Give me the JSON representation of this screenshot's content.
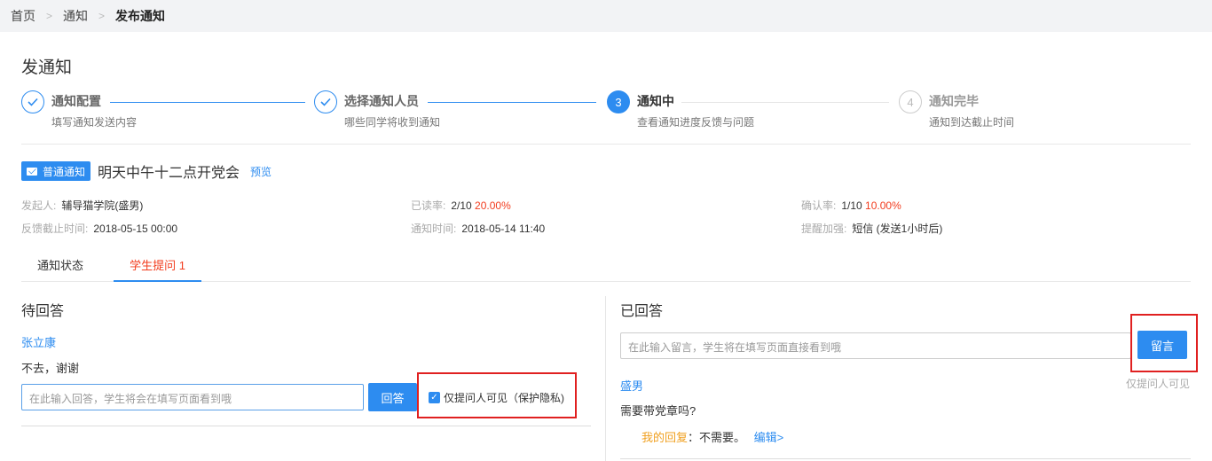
{
  "breadcrumb": {
    "home": "首页",
    "notice": "通知",
    "current": "发布通知"
  },
  "page_title": "发通知",
  "steps": [
    {
      "title": "通知配置",
      "desc": "填写通知发送内容",
      "status": "done",
      "icon": "check-icon"
    },
    {
      "title": "选择通知人员",
      "desc": "哪些同学将收到通知",
      "status": "done",
      "icon": "check-icon"
    },
    {
      "title": "通知中",
      "desc": "查看通知进度反馈与问题",
      "status": "active",
      "number": "3"
    },
    {
      "title": "通知完毕",
      "desc": "通知到达截止时间",
      "status": "todo",
      "number": "4"
    }
  ],
  "notice": {
    "badge": "普通通知",
    "title": "明天中午十二点开党会",
    "preview": "预览"
  },
  "meta": {
    "initiator_label": "发起人:",
    "initiator": "辅导猫学院(盛男)",
    "deadline_label": "反馈截止时间:",
    "deadline": "2018-05-15 00:00",
    "read_label": "已读率:",
    "read_count": "2/10",
    "read_pct": "20.00%",
    "notify_time_label": "通知时间:",
    "notify_time": "2018-05-14 11:40",
    "confirm_label": "确认率:",
    "confirm_count": "1/10",
    "confirm_pct": "10.00%",
    "remind_label": "提醒加强:",
    "remind": "短信 (发送1小时后)"
  },
  "tabs": {
    "status": "通知状态",
    "questions": "学生提问 1"
  },
  "pending": {
    "title": "待回答",
    "asker": "张立康",
    "question": "不去，谢谢",
    "reply_placeholder": "在此输入回答，学生将会在填写页面看到哦",
    "reply_button": "回答",
    "private_label": "仅提问人可见（保护隐私)",
    "private_checked": true
  },
  "answered": {
    "title": "已回答",
    "message_placeholder": "在此输入留言，学生将在填写页面直接看到哦",
    "message_button": "留言",
    "visibility_hint": "仅提问人可见",
    "asker": "盛男",
    "question": "需要带党章吗?",
    "my_reply_label": "我的回复",
    "my_reply": "：不需要。",
    "edit_link": "编辑>"
  },
  "colors": {
    "accent": "#2d8cf0",
    "danger": "#f23c1e",
    "highlight": "#e02020",
    "reply_label": "#f0a020"
  }
}
